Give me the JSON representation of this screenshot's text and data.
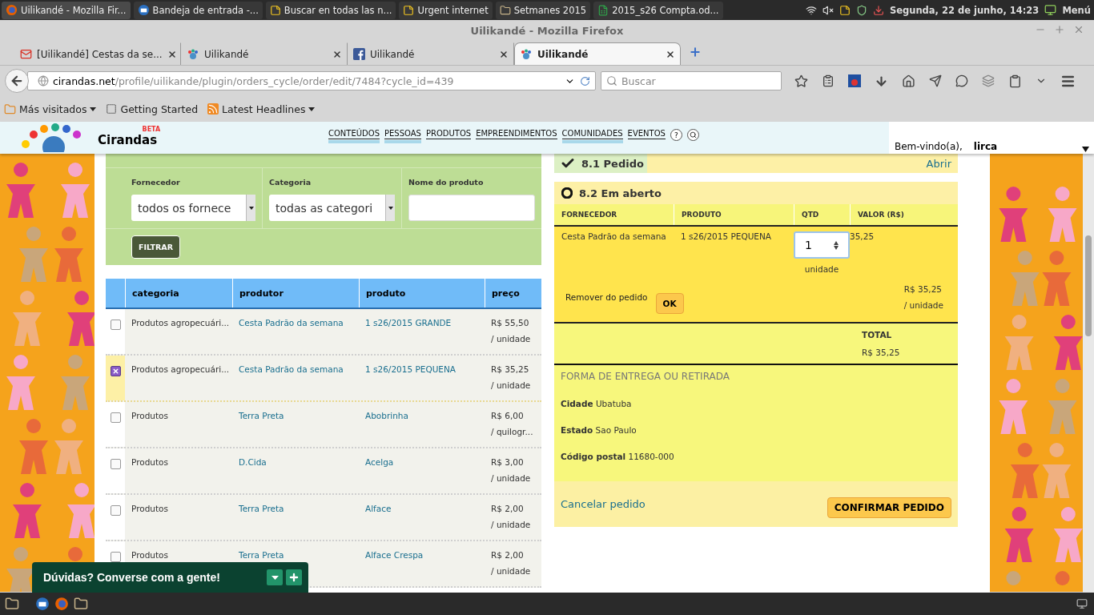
{
  "os_panel": {
    "windows": [
      {
        "title": "Uilikandé - Mozilla Fir...",
        "selected": true
      },
      {
        "title": "Bandeja de entrada -...",
        "selected": false
      },
      {
        "title": "Buscar en todas las n...",
        "selected": false
      },
      {
        "title": "Urgent internet",
        "selected": false
      },
      {
        "title": "Setmanes 2015",
        "selected": false
      },
      {
        "title": "2015_s26 Compta.od...",
        "selected": false
      }
    ],
    "clock": "Segunda, 22 de junho, 14:23",
    "menu": "Menú"
  },
  "window": {
    "title": "Uilikandé - Mozilla Firefox"
  },
  "tabs": [
    {
      "label": "[Uilikandé] Cestas da se...",
      "selected": false
    },
    {
      "label": "Uilikandé",
      "selected": false
    },
    {
      "label": "Uilikandé",
      "selected": false
    },
    {
      "label": "Uilikandé",
      "selected": true
    }
  ],
  "address": {
    "host": "cirandas.net",
    "path": "/profile/uilikande/plugin/orders_cycle/order/edit/7484?cycle_id=439"
  },
  "search": {
    "placeholder": "Buscar"
  },
  "bookmarks": [
    {
      "label": "Más visitados",
      "dropdown": true
    },
    {
      "label": "Getting Started",
      "dropdown": false
    },
    {
      "label": "Latest Headlines",
      "dropdown": true
    }
  ],
  "site": {
    "logo": "Cirandas",
    "beta": "BETA",
    "nav": [
      {
        "label": "CONTEÚDOS",
        "menu": true
      },
      {
        "label": "PESSOAS",
        "menu": true
      },
      {
        "label": "PRODUTOS",
        "menu": false
      },
      {
        "label": "EMPREENDIMENTOS",
        "menu": false
      },
      {
        "label": "COMUNIDADES",
        "menu": true
      },
      {
        "label": "EVENTOS",
        "menu": false
      }
    ],
    "help": "?",
    "welcome": "Bem-vindo(a),",
    "user": "lirca"
  },
  "filter": {
    "fields": [
      {
        "label": "Fornecedor",
        "kind": "select",
        "value": "todos os fornece"
      },
      {
        "label": "Categoria",
        "kind": "select",
        "value": "todas as categori"
      },
      {
        "label": "Nome do produto",
        "kind": "text"
      }
    ],
    "button": "FILTRAR"
  },
  "products": {
    "columns": [
      "categoria",
      "produtor",
      "produto",
      "preço"
    ],
    "rows": [
      {
        "checked": false,
        "category": "Produtos agropecuári...",
        "producer": "Cesta Padrão da semana",
        "product": "1 s26/2015 GRANDE",
        "price": "R$ 55,50",
        "unit": "/ unidade"
      },
      {
        "checked": true,
        "category": "Produtos agropecuári...",
        "producer": "Cesta Padrão da semana",
        "product": "1 s26/2015 PEQUENA",
        "price": "R$ 35,25",
        "unit": "/ unidade"
      },
      {
        "checked": false,
        "category": "Produtos",
        "producer": "Terra Preta",
        "product": "Abobrinha",
        "price": "R$ 6,00",
        "unit": "/ quilogr..."
      },
      {
        "checked": false,
        "category": "Produtos",
        "producer": "D.Cida",
        "product": "Acelga",
        "price": "R$ 3,00",
        "unit": "/ unidade"
      },
      {
        "checked": false,
        "category": "Produtos",
        "producer": "Terra Preta",
        "product": "Alface",
        "price": "R$ 2,00",
        "unit": "/ unidade"
      },
      {
        "checked": false,
        "category": "Produtos",
        "producer": "Terra Preta",
        "product": "Alface Crespa",
        "price": "R$ 2,00",
        "unit": "/ unidade"
      }
    ]
  },
  "order": {
    "steps": [
      {
        "title": "8.1 Pedido",
        "link": "Abrir"
      },
      {
        "title": "8.2 Em aberto"
      }
    ],
    "columns": [
      "FORNECEDOR",
      "PRODUTO",
      "QTD",
      "VALOR (R$)"
    ],
    "item": {
      "supplier": "Cesta Padrão da semana",
      "product": "1 s26/2015 PEQUENA",
      "qty": "1",
      "qty_unit": "unidade",
      "value": "35,25",
      "remove": "Remover do pedido",
      "ok": "OK",
      "price": "R$ 35,25",
      "price_unit": "/ unidade"
    },
    "total_label": "TOTAL",
    "total": "R$ 35,25",
    "delivery": {
      "heading": "FORMA DE ENTREGA OU RETIRADA",
      "fields": [
        {
          "label": "Cidade",
          "value": "Ubatuba"
        },
        {
          "label": "Estado",
          "value": "Sao Paulo"
        },
        {
          "label": "Código postal",
          "value": "11680-000"
        }
      ]
    },
    "cancel": "Cancelar pedido",
    "confirm": "CONFIRMAR PEDIDO"
  },
  "chat": {
    "title": "Dúvidas? Converse com a gente!"
  }
}
